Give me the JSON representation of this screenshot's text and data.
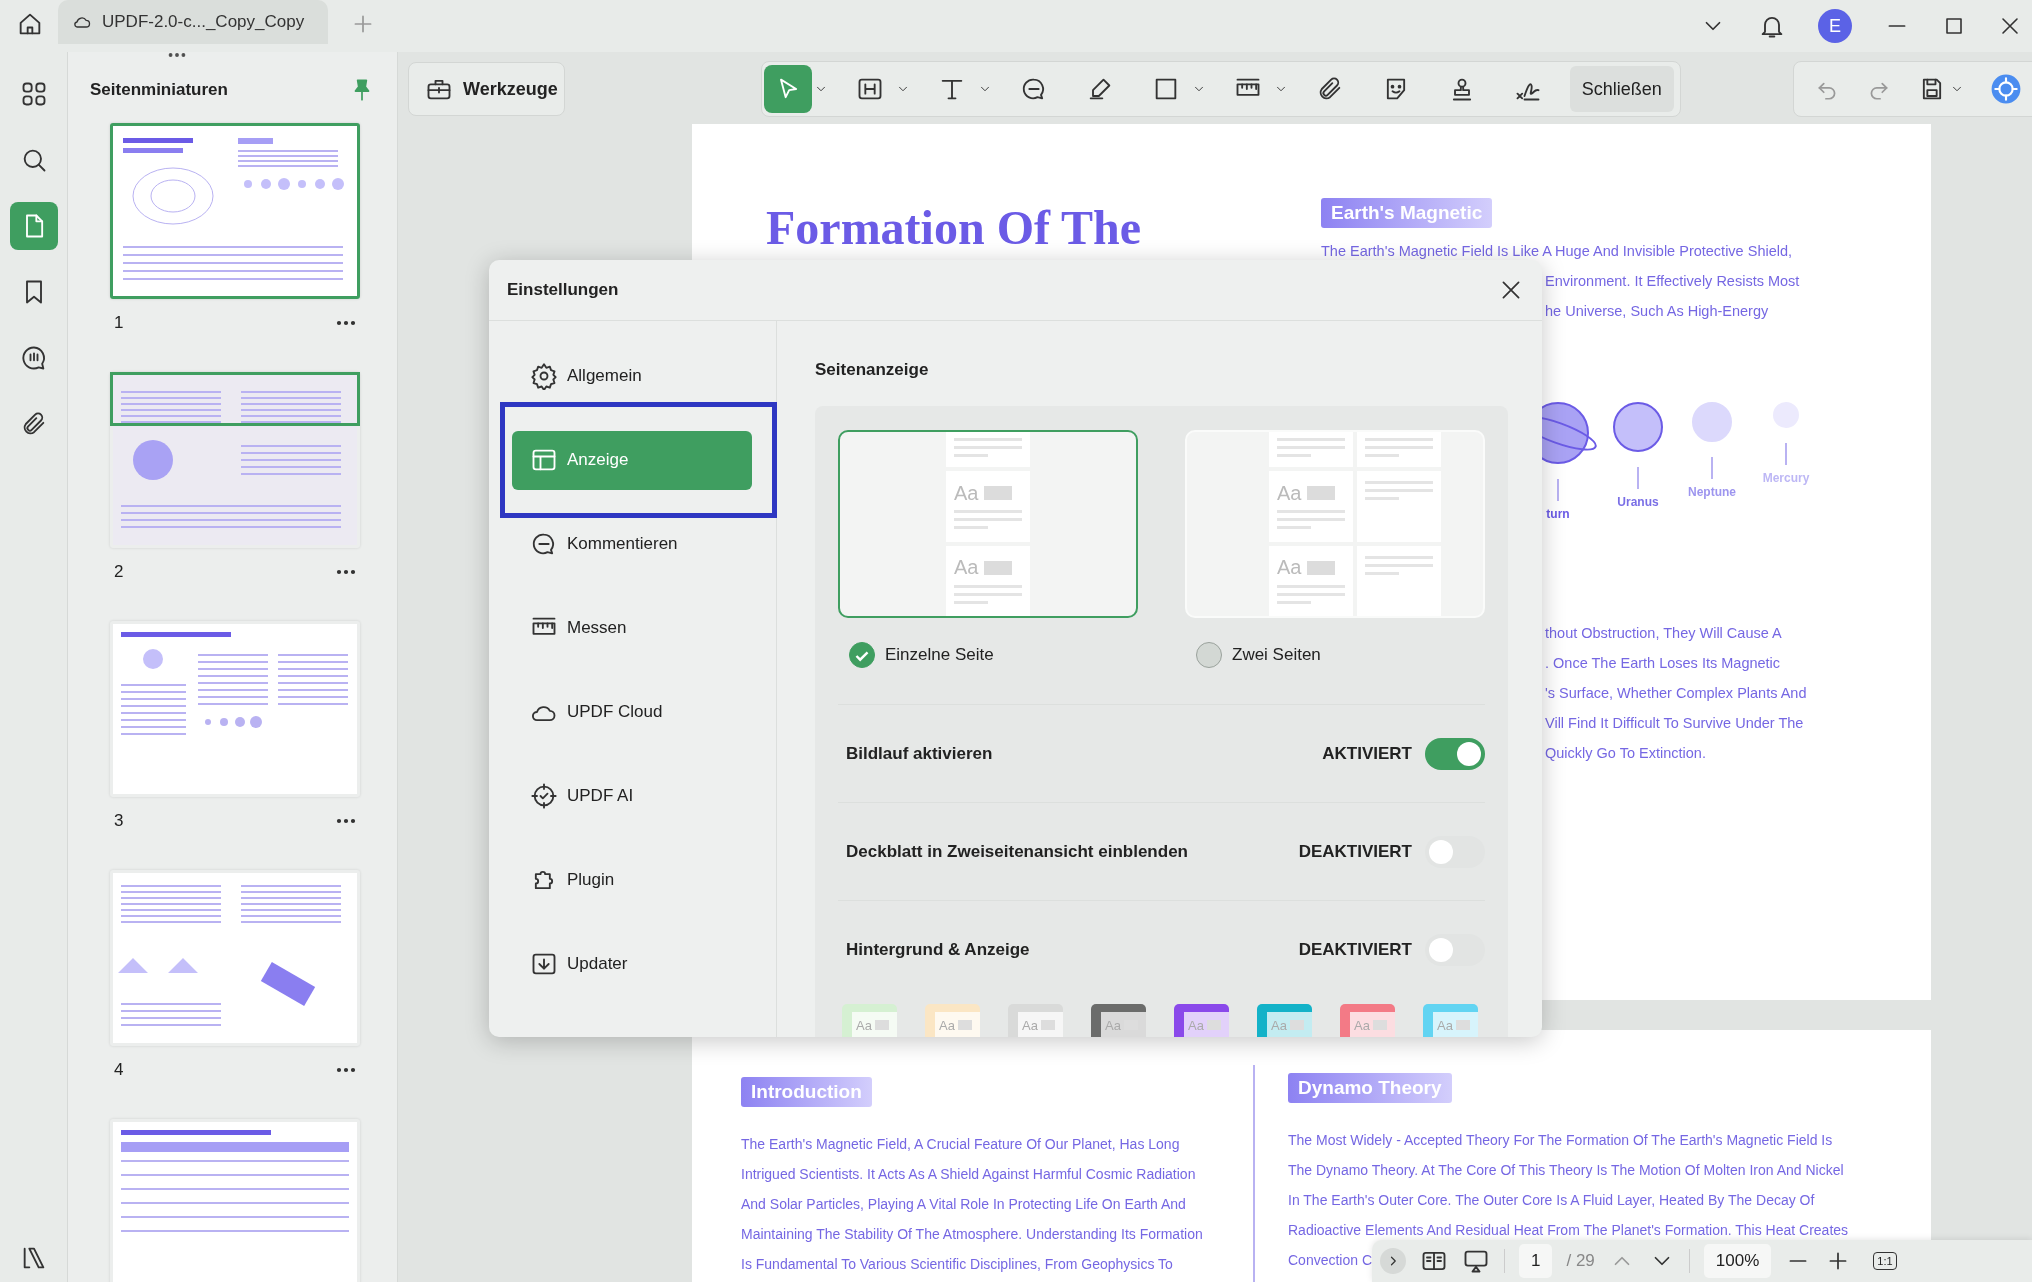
{
  "title_bar": {
    "tab_title": "UPDF-2.0-c..._Copy_Copy",
    "avatar": "E"
  },
  "left_rail": {
    "items": [
      {
        "selected": false
      },
      {
        "selected": false
      },
      {
        "selected": true
      },
      {
        "selected": false
      },
      {
        "selected": false
      },
      {
        "selected": false
      }
    ]
  },
  "thumbnails_panel": {
    "title": "Seitenminiaturen",
    "pages": [
      {
        "number": "1",
        "selected": true,
        "partly_in_view": false
      },
      {
        "number": "2",
        "selected": false,
        "partly_in_view": true
      },
      {
        "number": "3",
        "selected": false,
        "partly_in_view": false
      },
      {
        "number": "4",
        "selected": false,
        "partly_in_view": false
      },
      {
        "selected": false,
        "partly_in_view": false
      }
    ]
  },
  "toolbar": {
    "tools_button": "Werkzeuge",
    "tools": [
      {
        "selected": true,
        "has_menu": true
      },
      {
        "selected": false,
        "has_menu": true
      },
      {
        "selected": false,
        "has_menu": true
      },
      {
        "selected": false,
        "has_menu": false
      },
      {
        "selected": false,
        "has_menu": false
      },
      {
        "selected": false,
        "has_menu": true
      },
      {
        "selected": false,
        "has_menu": true
      },
      {
        "selected": false,
        "has_menu": false
      },
      {
        "selected": false,
        "has_menu": false
      },
      {
        "selected": false,
        "has_menu": false
      },
      {
        "selected": false,
        "has_menu": false
      }
    ],
    "close_button": "Schließen"
  },
  "document": {
    "page_1": {
      "title": "Formation Of The",
      "heading": "Earth's Magnetic",
      "lines": [
        {
          "text": "The Earth's Magnetic Field Is Like A Huge And Invisible Protective Shield,",
          "cut_by_dialog": false
        },
        {
          "text": "Environment. It Effectively Resists Most",
          "cut_by_dialog": true
        },
        {
          "text": "he Universe, Such As High-Energy",
          "cut_by_dialog": true
        }
      ],
      "planets": [
        {
          "label": "turn",
          "color": "#a9a2f4"
        },
        {
          "label": "Uranus",
          "color": "#c4bffa"
        },
        {
          "label": "Neptune",
          "color": "#dcd9fc"
        },
        {
          "label": "Mercury",
          "color": "#eceafd"
        }
      ],
      "lines_2": [
        {
          "text": "thout Obstruction, They Will Cause A",
          "cut_by_dialog": true
        },
        {
          "text": ". Once The Earth Loses Its Magnetic",
          "cut_by_dialog": true
        },
        {
          "text": "'s Surface, Whether Complex Plants And",
          "cut_by_dialog": true
        },
        {
          "text": "Vill Find It Difficult To Survive Under The",
          "cut_by_dialog": true
        },
        {
          "text": "Quickly Go To Extinction.",
          "cut_by_dialog": true
        }
      ]
    },
    "page_2": {
      "columns": [
        {
          "heading": "Introduction",
          "lines": [
            "The Earth's Magnetic Field, A Crucial Feature Of Our Planet, Has Long",
            "Intrigued Scientists. It Acts As A Shield Against Harmful Cosmic Radiation",
            "And Solar Particles, Playing A Vital Role In Protecting Life On Earth And",
            "Maintaining The Stability Of The Atmosphere. Understanding Its Formation",
            "Is Fundamental To Various Scientific Disciplines, From Geophysics To"
          ]
        },
        {
          "heading": "Dynamo Theory",
          "lines": [
            "The Most Widely - Accepted Theory For The Formation Of The Earth's Magnetic Field Is",
            "The Dynamo Theory. At The Core Of This Theory Is The Motion Of Molten Iron And Nickel",
            "In The Earth's Outer Core. The Outer Core Is A Fluid Layer, Heated By The Decay Of",
            "Radioactive Elements And Residual Heat From The Planet's Formation. This Heat Creates",
            "Convection C"
          ]
        }
      ]
    }
  },
  "dialog": {
    "title": "Einstellungen",
    "nav": [
      {
        "label": "Allgemein",
        "selected": false,
        "annotated": false
      },
      {
        "label": "Anzeige",
        "selected": true,
        "annotated": true
      },
      {
        "label": "Kommentieren",
        "selected": false,
        "annotated": false
      },
      {
        "label": "Messen",
        "selected": false,
        "annotated": false
      },
      {
        "label": "UPDF Cloud",
        "selected": false,
        "annotated": false
      },
      {
        "label": "UPDF AI",
        "selected": false,
        "annotated": false
      },
      {
        "label": "Plugin",
        "selected": false,
        "annotated": false
      },
      {
        "label": "Updater",
        "selected": false,
        "annotated": false
      }
    ],
    "section_title": "Seitenanzeige",
    "layouts": [
      {
        "kind": "single",
        "label": "Einzelne Seite",
        "selected": true,
        "samples": [
          "Aa",
          "Aa"
        ]
      },
      {
        "kind": "double",
        "label": "Zwei Seiten",
        "selected": false,
        "samples": [
          "Aa",
          "Aa"
        ]
      }
    ],
    "settings": [
      {
        "label": "Bildlauf aktivieren",
        "state_label": "AKTIVIERT",
        "on": true
      },
      {
        "label": "Deckblatt in Zweiseitenansicht einblenden",
        "state_label": "DEAKTIVIERT",
        "on": false
      },
      {
        "label": "Hintergrund & Anzeige",
        "state_label": "DEAKTIVIERT",
        "on": false
      }
    ],
    "themes": [
      {
        "color": "#d5f0d2",
        "sample": "Aa"
      },
      {
        "color": "#fbe6c4",
        "sample": "Aa"
      },
      {
        "color": "#d9dad9",
        "sample": "Aa"
      },
      {
        "color": "#6b6c6b",
        "sample": "Aa"
      },
      {
        "color": "#8a49ea",
        "sample": "Aa"
      },
      {
        "color": "#13b2c8",
        "sample": "Aa"
      },
      {
        "color": "#f37a86",
        "sample": "Aa"
      },
      {
        "color": "#62d4f2",
        "sample": "Aa"
      }
    ]
  },
  "bottom_bar": {
    "page": "1",
    "page_count": "/ 29",
    "zoom": "100%",
    "actual_size": "1:1"
  }
}
